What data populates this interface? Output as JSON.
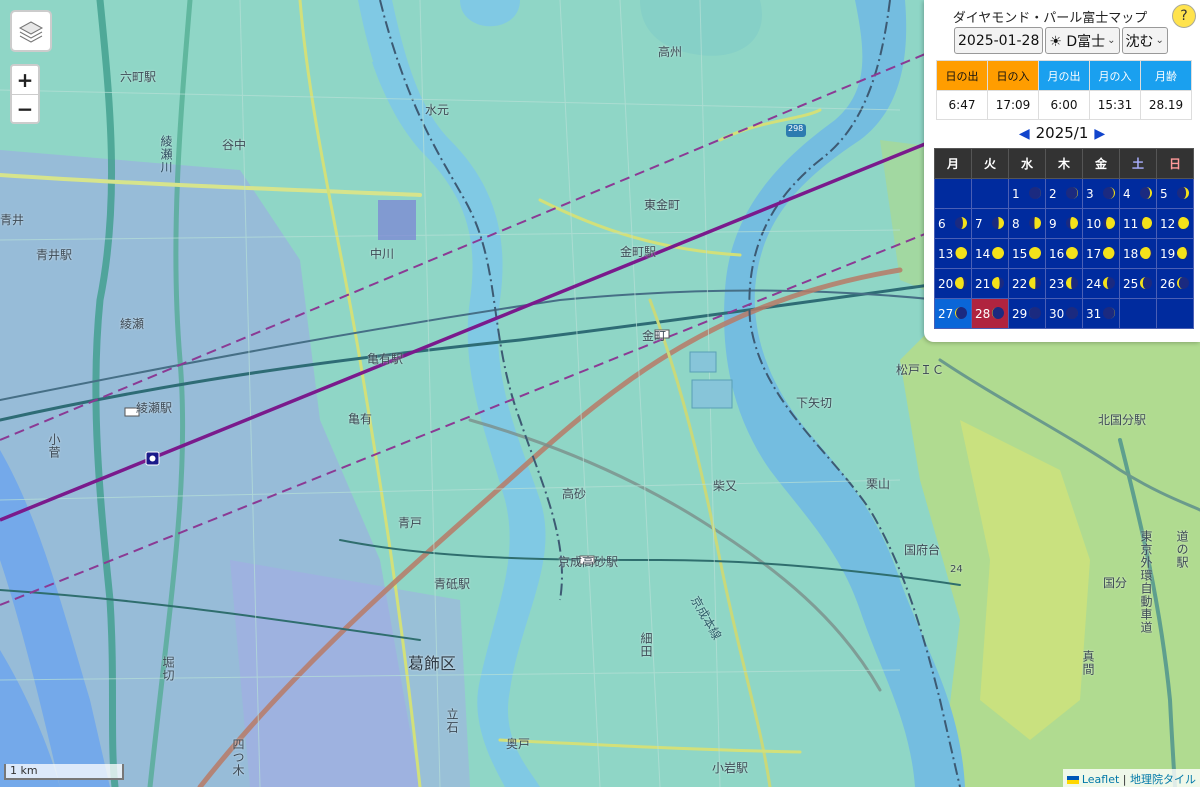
{
  "panel": {
    "title": "ダイヤモンド・パール富士マップ",
    "help": "?",
    "date": "2025-01-28",
    "type": "☀ D富士",
    "mode": "沈む",
    "sun_headers": [
      "日の出",
      "日の入",
      "月の出",
      "月の入",
      "月齢"
    ],
    "sun_values": [
      "6:47",
      "17:09",
      "6:00",
      "15:31",
      "28.19"
    ],
    "month": "2025/1",
    "weekdays": [
      "月",
      "火",
      "水",
      "木",
      "金",
      "土",
      "日"
    ],
    "calendar": [
      [
        "",
        "",
        "1",
        "2",
        "3",
        "4",
        "5"
      ],
      [
        "6",
        "7",
        "8",
        "9",
        "10",
        "11",
        "12"
      ],
      [
        "13",
        "14",
        "15",
        "16",
        "17",
        "18",
        "19"
      ],
      [
        "20",
        "21",
        "22",
        "23",
        "24",
        "25",
        "26"
      ],
      [
        "27",
        "28",
        "29",
        "30",
        "31",
        "",
        ""
      ]
    ],
    "today": "27",
    "selected": "28"
  },
  "controls": {
    "zoom_in": "+",
    "zoom_out": "−"
  },
  "scale": "1 km",
  "attribution": {
    "leaflet": "Leaflet",
    "sep": "|",
    "tiles": "地理院タイル"
  },
  "labels": {
    "rokucho": "六町駅",
    "yanaka": "谷中",
    "mizumoto": "水元",
    "koshu": "高州",
    "higashikanamachi": "東金町",
    "kanamachi_st": "金町駅",
    "nakagawa": "中川",
    "aoi": "青井",
    "aoi_st": "青井駅",
    "ayase": "綾瀬",
    "ayase_st": "綾瀬駅",
    "kameari_st": "亀有駅",
    "kameari": "亀有",
    "kosuge": "小菅",
    "kanamachi": "金町",
    "aoto": "青戸",
    "takasago": "高砂",
    "keisei_takasago": "京成高砂駅",
    "aoto_st": "青砥駅",
    "shibamata": "柴又",
    "katsushika": "葛飾区",
    "hosoda": "細田",
    "tateishi": "立石",
    "horikiri": "堀切",
    "yotsugi": "四つ木",
    "okudo": "奥戸",
    "koiwa_st": "小岩駅",
    "matsudo_ic": "松戸ＩＣ",
    "shimoyagiri": "下矢切",
    "kitakokubun": "北国分駅",
    "kuriyama": "栗山",
    "kokufudai": "国府台",
    "kokubun": "国分",
    "mama": "真間",
    "gaikan": "東京外環自動車道",
    "ayasegawa": "綾瀬川",
    "keisei_line": "京成本線",
    "route298": "298",
    "elev24": "24",
    "michino": "道の駅"
  }
}
